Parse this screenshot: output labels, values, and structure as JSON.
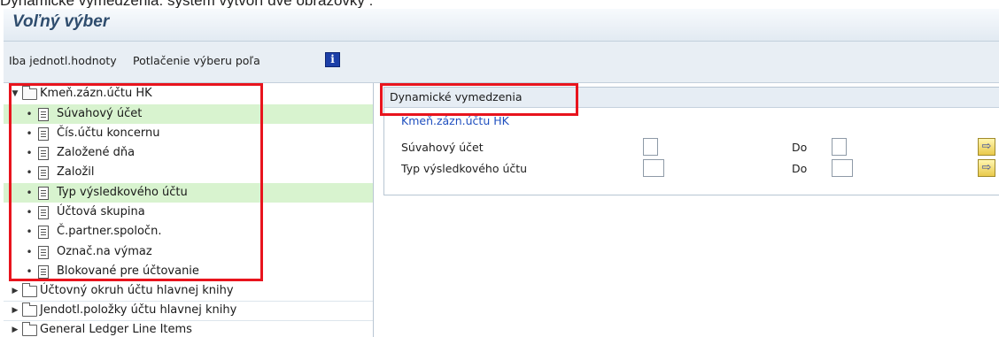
{
  "doc_caption": "Dynamické vymedzenia: systém vytvorí dve obrazovky :",
  "screen": {
    "title": "Voľný výber"
  },
  "toolbar": {
    "single_values_label": "Iba jednotl.hodnoty",
    "suppress_field_selection_label": "Potlačenie výberu poľa",
    "info_label": "i"
  },
  "tree": {
    "root": {
      "label": "Kmeň.zázn.účtu HK",
      "expanded": true
    },
    "fields": [
      {
        "label": "Súvahový účet",
        "selected": true
      },
      {
        "label": "Čís.účtu koncernu",
        "selected": false
      },
      {
        "label": "Založené dňa",
        "selected": false
      },
      {
        "label": "Založil",
        "selected": false
      },
      {
        "label": "Typ výsledkového účtu",
        "selected": true
      },
      {
        "label": "Účtová skupina",
        "selected": false
      },
      {
        "label": "Č.partner.spoločn.",
        "selected": false
      },
      {
        "label": "Označ.na výmaz",
        "selected": false
      },
      {
        "label": "Blokované pre účtovanie",
        "selected": false
      }
    ],
    "collapsed_nodes": [
      {
        "label": "Účtovný okruh účtu hlavnej knihy"
      },
      {
        "label": "Jendotl.položky účtu hlavnej knihy"
      },
      {
        "label": "General Ledger Line Items"
      }
    ]
  },
  "dynamic_selections": {
    "header": "Dynamické vymedzenia",
    "group_label": "Kmeň.zázn.účtu HK",
    "rows": [
      {
        "label": "Súvahový účet",
        "from_value": "",
        "to_label": "Do",
        "to_value": ""
      },
      {
        "label": "Typ výsledkového účtu",
        "from_value": "",
        "to_label": "Do",
        "to_value": ""
      }
    ],
    "multiple_selection_icon": "⇨"
  },
  "colors": {
    "highlight_row": "#d8f3cf",
    "annotation_red": "#e8141d",
    "group_label_blue": "#1f4fbf",
    "title_text": "#2e4c6d"
  }
}
